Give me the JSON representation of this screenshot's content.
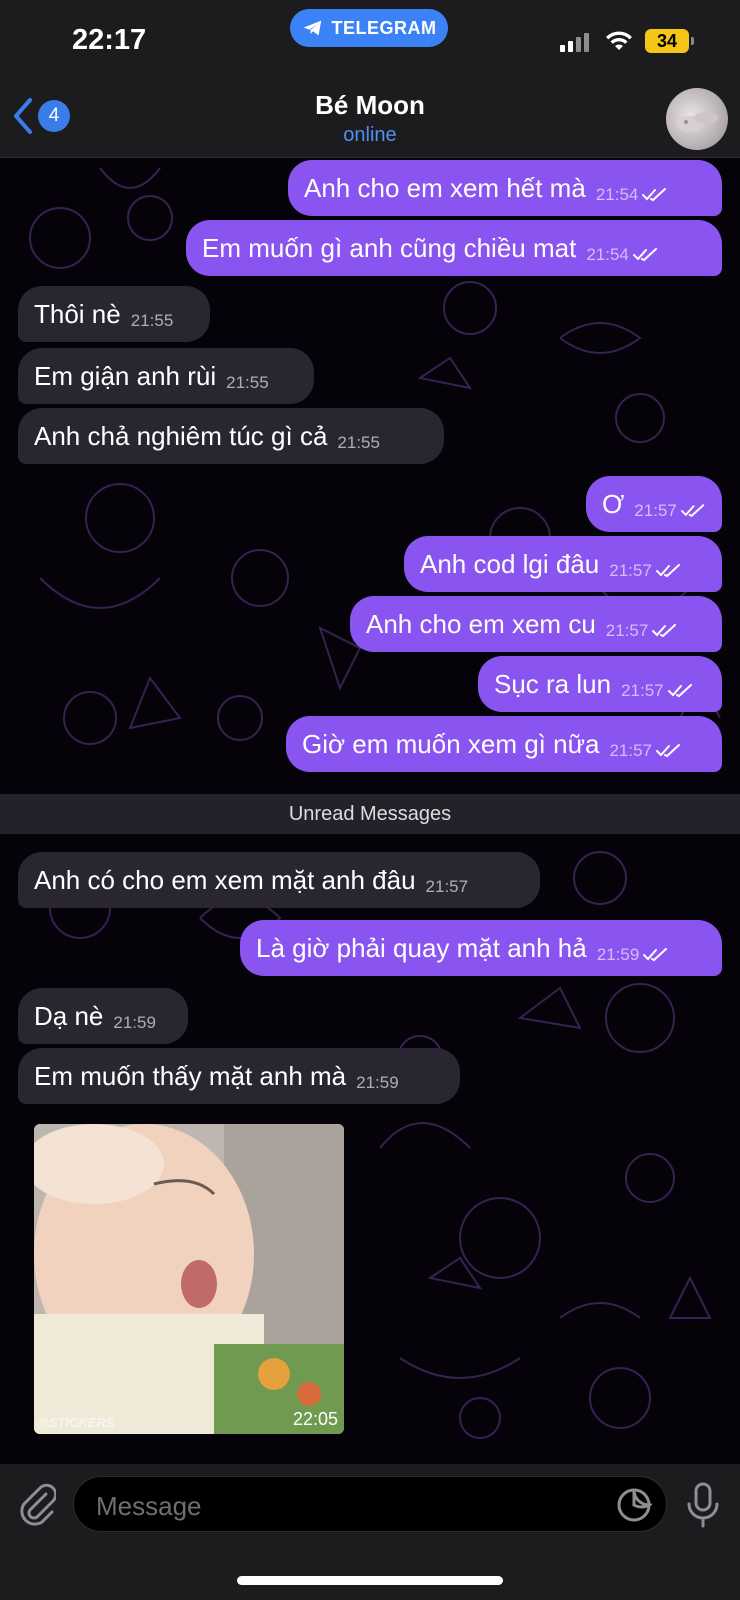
{
  "status_bar": {
    "time": "22:17",
    "app_pill": "TELEGRAM",
    "battery": "34"
  },
  "header": {
    "back_count": "4",
    "title": "Bé Moon",
    "status": "online"
  },
  "messages": [
    {
      "dir": "out",
      "text": "Anh cho em xem hết mà",
      "time": "21:54"
    },
    {
      "dir": "out",
      "text": "Em muốn gì anh cũng chiều mat",
      "time": "21:54"
    },
    {
      "dir": "in",
      "text": "Thôi nè",
      "time": "21:55"
    },
    {
      "dir": "in",
      "text": "Em giận anh rùi",
      "time": "21:55"
    },
    {
      "dir": "in",
      "text": "Anh chả nghiêm túc gì cả",
      "time": "21:55"
    },
    {
      "dir": "out",
      "text": "Ơ",
      "time": "21:57"
    },
    {
      "dir": "out",
      "text": "Anh cod lgi đâu",
      "time": "21:57"
    },
    {
      "dir": "out",
      "text": "Anh cho em xem cu",
      "time": "21:57"
    },
    {
      "dir": "out",
      "text": "Sục ra lun",
      "time": "21:57"
    },
    {
      "dir": "out",
      "text": "Giờ em muốn xem gì nữa",
      "time": "21:57"
    },
    {
      "dir": "in",
      "text": "Anh có cho em xem mặt anh đâu",
      "time": "21:57"
    },
    {
      "dir": "out",
      "text": "Là giờ phải quay mặt anh hả",
      "time": "21:59"
    },
    {
      "dir": "in",
      "text": "Dạ nè",
      "time": "21:59"
    },
    {
      "dir": "in",
      "text": "Em muốn thấy mặt anh mà",
      "time": "21:59"
    }
  ],
  "unread_label": "Unread Messages",
  "sticker_message": {
    "time": "22:05",
    "watermark": "@STICKERS"
  },
  "input": {
    "placeholder": "Message"
  },
  "colors": {
    "outgoing_bubble": "#8a54f0",
    "incoming_bubble": "#2a2631",
    "accent": "#3a7de8"
  }
}
